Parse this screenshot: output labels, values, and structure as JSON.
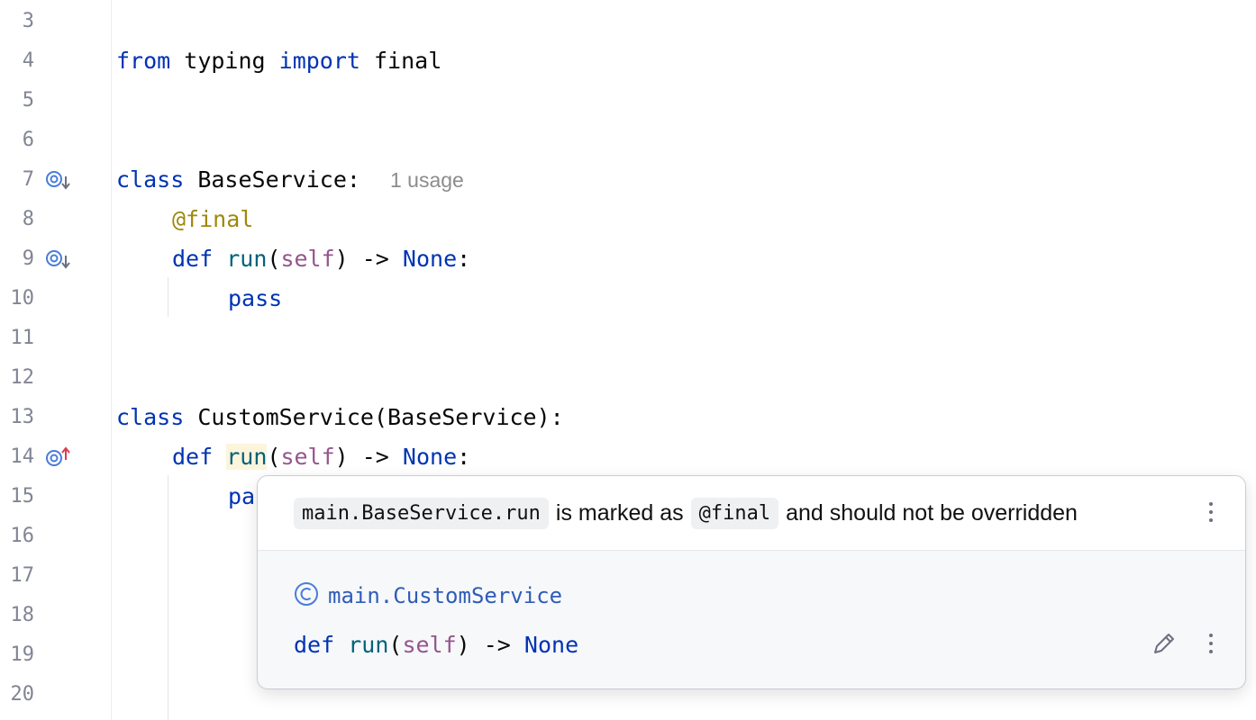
{
  "editor": {
    "lines": [
      {
        "num": "3"
      },
      {
        "num": "4",
        "from": "from",
        "module": " typing ",
        "import": "import",
        "name": " final"
      },
      {
        "num": "5"
      },
      {
        "num": "6"
      },
      {
        "num": "7",
        "kw": "class",
        "text": " BaseService:",
        "hint": "1 usage",
        "gutter_icon": "implemented-icon"
      },
      {
        "num": "8",
        "decorator": "@final"
      },
      {
        "num": "9",
        "kw": "def",
        "fn": "run",
        "p1": "(",
        "self": "self",
        "p2": ") -> ",
        "none": "None",
        "colon": ":",
        "gutter_icon": "overridden-icon"
      },
      {
        "num": "10",
        "kw": "pass"
      },
      {
        "num": "11"
      },
      {
        "num": "12"
      },
      {
        "num": "13",
        "kw": "class",
        "text": " CustomService(BaseService):"
      },
      {
        "num": "14",
        "kw": "def",
        "fn": "run",
        "p1": "(",
        "self": "self",
        "p2": ") -> ",
        "none": "None",
        "colon": ":",
        "gutter_icon": "overriding-icon"
      },
      {
        "num": "15",
        "kw": "pa"
      },
      {
        "num": "16"
      },
      {
        "num": "17"
      },
      {
        "num": "18"
      },
      {
        "num": "19"
      },
      {
        "num": "20"
      }
    ]
  },
  "popup": {
    "chip_target": "main.BaseService.run",
    "text_middle": "is marked as",
    "chip_decorator": "@final",
    "text_end": "and should not be overridden",
    "target_class": "main.CustomService",
    "class_icon": "class-icon",
    "signature": {
      "kw": "def",
      "fn": "run",
      "p1": "(",
      "self": "self",
      "p2": ") -> ",
      "none": "None"
    }
  },
  "colors": {
    "keyword": "#0033b3",
    "self": "#94558d",
    "decorator": "#9e880d",
    "hint": "#8c8c8c",
    "link": "#2f5cb8"
  }
}
